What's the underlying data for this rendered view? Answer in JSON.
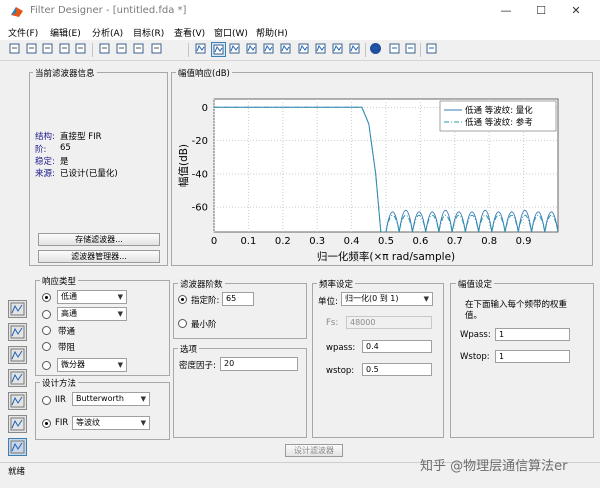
{
  "window": {
    "title": "Filter Designer - [untitled.fda *]",
    "minimize": "—",
    "maximize": "☐",
    "close": "✕"
  },
  "menu": [
    "文件(F)",
    "编辑(E)",
    "分析(A)",
    "目标(R)",
    "查看(V)",
    "窗口(W)",
    "帮助(H)"
  ],
  "toolbar": {
    "icons": [
      "new-file-icon",
      "open-file-icon",
      "save-icon",
      "print-icon",
      "print-preview-icon",
      "zoom-in-icon",
      "zoom-x-icon",
      "zoom-y-icon",
      "full-view-icon",
      "filter-specs-icon",
      "magnitude-response-icon",
      "phase-response-icon",
      "mag-phase-icon",
      "group-delay-icon",
      "phase-delay-icon",
      "impulse-response-icon",
      "step-response-icon",
      "pole-zero-icon",
      "coefficients-icon",
      "info-icon",
      "cost-icon",
      "noise-icon",
      "whats-this-icon"
    ],
    "active_index": 10
  },
  "filter_info": {
    "title": "当前滤波器信息",
    "rows": [
      {
        "key": "结构:",
        "value": "直接型 FIR"
      },
      {
        "key": "阶:",
        "value": "65"
      },
      {
        "key": "稳定:",
        "value": "是"
      },
      {
        "key": "来源:",
        "value": "已设计(已量化)"
      }
    ],
    "store_button": "存储滤波器...",
    "manager_button": "滤波器管理器..."
  },
  "plot_panel": {
    "title": "幅值响应(dB)"
  },
  "chart_data": {
    "type": "line",
    "xlabel": "归一化频率(×π rad/sample)",
    "ylabel": "幅值(dB)",
    "xlim": [
      0,
      1
    ],
    "ylim": [
      -75,
      5
    ],
    "xticks": [
      "0",
      "0.1",
      "0.2",
      "0.3",
      "0.4",
      "0.5",
      "0.6",
      "0.7",
      "0.8",
      "0.9"
    ],
    "yticks": [
      "0",
      "-20",
      "-40",
      "-60"
    ],
    "grid": true,
    "legend_position": "top-right",
    "series": [
      {
        "name": "低通 等波纹: 量化",
        "style": "solid",
        "color": "#3a78b8",
        "passband": [
          [
            0,
            0
          ],
          [
            0.43,
            0
          ],
          [
            0.45,
            -10
          ],
          [
            0.47,
            -40
          ],
          [
            0.485,
            -75
          ]
        ],
        "stopband_start": 0.5,
        "stopband_peak_db": -58
      },
      {
        "name": "低通 等波纹: 参考",
        "style": "dash-dot",
        "color": "#2a9aa8",
        "passband": [
          [
            0,
            0
          ],
          [
            0.43,
            0
          ],
          [
            0.45,
            -10
          ],
          [
            0.47,
            -40
          ],
          [
            0.485,
            -75
          ]
        ],
        "stopband_start": 0.5,
        "stopband_peak_db": -62
      }
    ]
  },
  "response_type": {
    "title": "响应类型",
    "options": [
      {
        "label": "低通",
        "selected": true,
        "select": "低通"
      },
      {
        "label": "高通",
        "selected": false,
        "select": "高通"
      },
      {
        "label": "带通",
        "selected": false
      },
      {
        "label": "带阻",
        "selected": false
      },
      {
        "label": "",
        "selected": false,
        "select": "微分器"
      }
    ]
  },
  "design_method": {
    "title": "设计方法",
    "options": [
      {
        "label": "IIR",
        "selected": false,
        "select": "Butterworth"
      },
      {
        "label": "FIR",
        "selected": true,
        "select": "等波纹"
      }
    ]
  },
  "filter_order": {
    "title": "滤波器阶数",
    "specify_label": "指定阶:",
    "specify_value": "65",
    "minimum_label": "最小阶"
  },
  "options_group": {
    "title": "选项",
    "density_label": "密度因子:",
    "density_value": "20"
  },
  "freq_spec": {
    "title": "频率设定",
    "unit_label": "单位:",
    "unit_value": "归一化(0 到 1)",
    "fs_label": "Fs:",
    "fs_value": "48000",
    "wpass_label": "wpass:",
    "wpass_value": "0.4",
    "wstop_label": "wstop:",
    "wstop_value": "0.5"
  },
  "mag_spec": {
    "title": "幅值设定",
    "description": "在下面输入每个频带的权重值。",
    "wpass_label": "Wpass:",
    "wpass_value": "1",
    "wstop_label": "Wstop:",
    "wstop_value": "1"
  },
  "design_button": "设计滤波器",
  "status": "就绪",
  "watermark": "知乎 @物理层通信算法er",
  "side_icons": [
    "pole-zero-editor-icon",
    "transform-filter-icon",
    "multirate-icon",
    "quantize-icon",
    "realize-model-icon",
    "import-filter-icon",
    "design-filter-icon"
  ]
}
